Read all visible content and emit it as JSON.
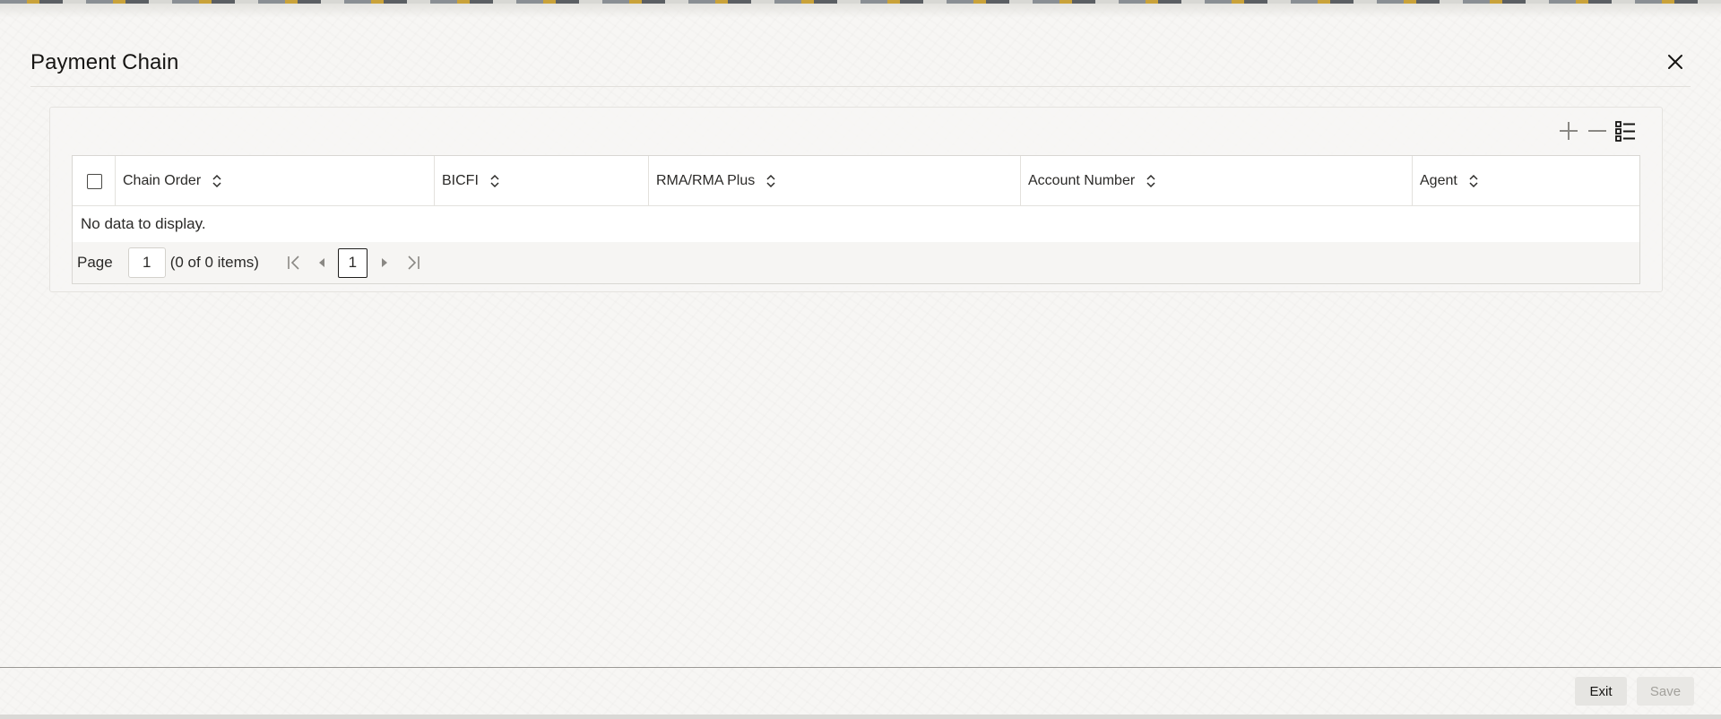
{
  "dialog": {
    "title": "Payment Chain",
    "close_icon": "close-icon"
  },
  "toolbar": {
    "icons": [
      "add-row-icon",
      "remove-row-icon",
      "column-list-icon"
    ]
  },
  "grid": {
    "columns": [
      {
        "label": "Chain Order"
      },
      {
        "label": "BICFI"
      },
      {
        "label": "RMA/RMA Plus"
      },
      {
        "label": "Account Number"
      },
      {
        "label": "Agent"
      }
    ],
    "empty_message": "No data to display."
  },
  "pagination": {
    "label": "Page",
    "page_input_value": "1",
    "count_text": "(0 of 0 items)",
    "current_page": "1",
    "nav_icons": [
      "first-page-icon",
      "previous-page-icon",
      "next-page-icon",
      "last-page-icon"
    ]
  },
  "footer": {
    "exit_label": "Exit",
    "save_label": "Save"
  },
  "colors": {
    "text": "#161513",
    "disabled_text": "#a3a19c",
    "button_bg": "#e6e5e2"
  }
}
